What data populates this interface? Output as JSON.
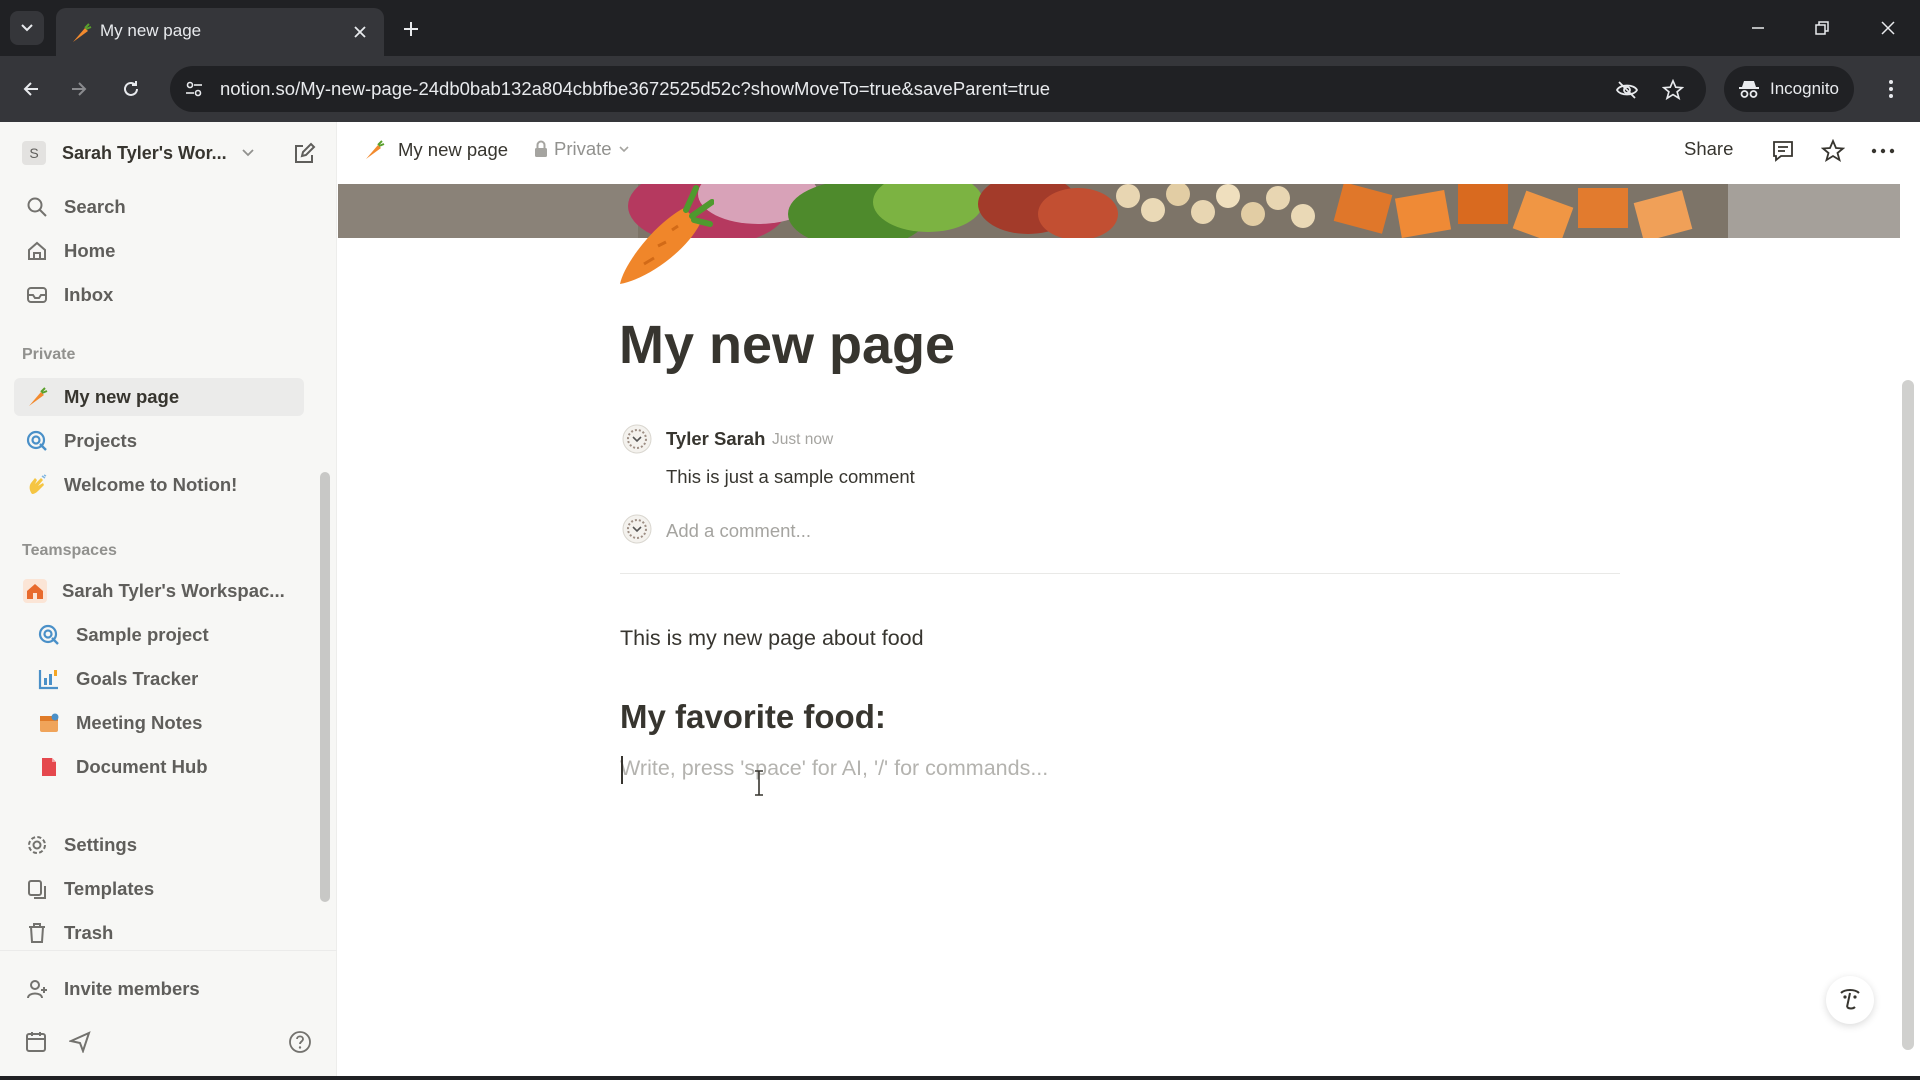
{
  "browser": {
    "tab_title": "My new page",
    "url": "notion.so/My-new-page-24db0bab132a804cbbfbe3672525d52c?showMoveTo=true&saveParent=true",
    "incognito_label": "Incognito"
  },
  "sidebar": {
    "workspace_initial": "S",
    "workspace_name": "Sarah Tyler's Wor...",
    "top_items": [
      {
        "label": "Search",
        "icon": "search-icon"
      },
      {
        "label": "Home",
        "icon": "home-icon"
      },
      {
        "label": "Inbox",
        "icon": "inbox-icon"
      }
    ],
    "private_label": "Private",
    "private_items": [
      {
        "label": "My new page",
        "icon": "carrot-icon",
        "active": true
      },
      {
        "label": "Projects",
        "icon": "target-icon"
      },
      {
        "label": "Welcome to Notion!",
        "icon": "wave-hand-icon"
      }
    ],
    "teamspaces_label": "Teamspaces",
    "teamspace": {
      "label": "Sarah Tyler's Workspac...",
      "icon": "house-icon"
    },
    "teamspace_items": [
      {
        "label": "Sample project",
        "icon": "target-icon"
      },
      {
        "label": "Goals Tracker",
        "icon": "chart-icon"
      },
      {
        "label": "Meeting Notes",
        "icon": "calendar-icon"
      },
      {
        "label": "Document Hub",
        "icon": "document-icon"
      }
    ],
    "bottom_items": [
      {
        "label": "Settings",
        "icon": "gear-icon"
      },
      {
        "label": "Templates",
        "icon": "templates-icon"
      },
      {
        "label": "Trash",
        "icon": "trash-icon"
      }
    ],
    "invite_label": "Invite members"
  },
  "topbar": {
    "page_title": "My new page",
    "privacy": "Private",
    "share_label": "Share"
  },
  "page": {
    "title": "My new page",
    "comment": {
      "author": "Tyler Sarah",
      "time": "Just now",
      "body": "This is just a sample comment",
      "input_placeholder": "Add a comment..."
    },
    "paragraph": "This is my new page about food",
    "heading": "My favorite food:",
    "block_placeholder": "Write, press 'space' for AI, '/' for commands..."
  },
  "colors": {
    "sidebar_bg": "#f7f7f5",
    "text": "#37352f",
    "muted": "#91918e",
    "browser_dark": "#202124",
    "browser_toolbar": "#35363a"
  }
}
